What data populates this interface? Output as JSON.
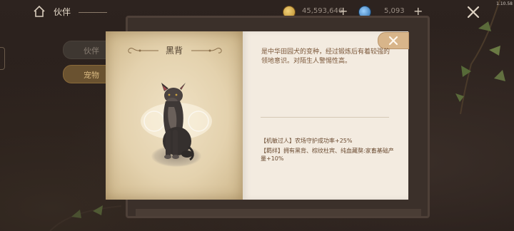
{
  "header": {
    "title": "伙伴",
    "coins": "45,593,646",
    "gems": "5,093",
    "version": "1.10.58"
  },
  "side_tabs": [
    {
      "label": "伙伴"
    },
    {
      "label": "宠物"
    }
  ],
  "pet": {
    "name": "黑背",
    "description": "是中华田园犬的变种，经过锻炼后有着较强的领地意识。对陌生人警惕性高。",
    "traits": [
      "【机敏过人】农场守护成功率+25%",
      "【羁绊】拥有黑背、棕纹杜宾、纯血藏獒:家畜基础产量+10%"
    ]
  }
}
